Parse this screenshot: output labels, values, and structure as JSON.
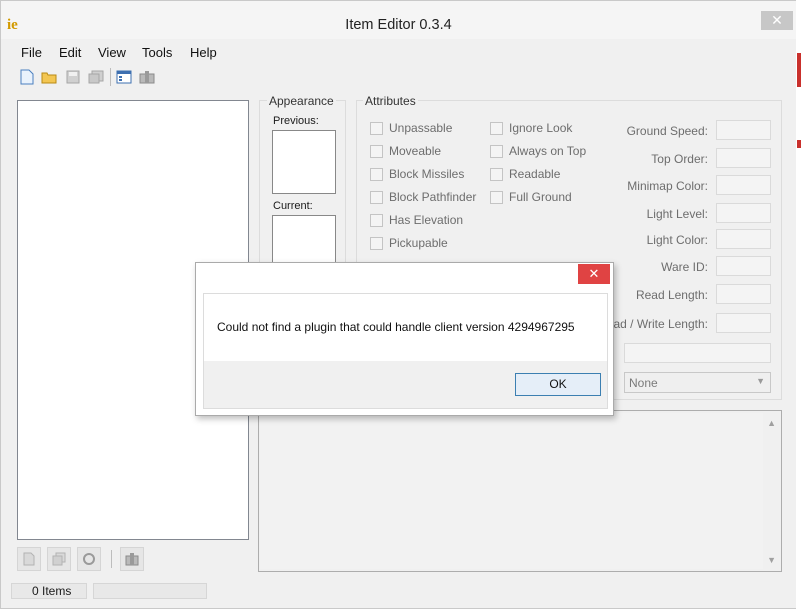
{
  "window": {
    "title": "Item Editor 0.3.4",
    "app_icon_text": "ie",
    "close_label": "✕"
  },
  "menu": [
    {
      "label": "File"
    },
    {
      "label": "Edit"
    },
    {
      "label": "View"
    },
    {
      "label": "Tools"
    },
    {
      "label": "Help"
    }
  ],
  "toolbar": [
    "new-file-icon",
    "open-folder-icon",
    "save-icon",
    "save-as-icon",
    "item-properties-icon",
    "find-item-icon"
  ],
  "appearance": {
    "title": "Appearance",
    "previous_label": "Previous:",
    "current_label": "Current:"
  },
  "attributes": {
    "title": "Attributes",
    "left_checks": [
      {
        "label": "Unpassable"
      },
      {
        "label": "Moveable"
      },
      {
        "label": "Block Missiles"
      },
      {
        "label": "Block Pathfinder"
      },
      {
        "label": "Has Elevation"
      },
      {
        "label": "Pickupable"
      }
    ],
    "right_checks": [
      {
        "label": "Ignore Look"
      },
      {
        "label": "Always on Top"
      },
      {
        "label": "Readable"
      },
      {
        "label": "Full Ground"
      }
    ],
    "properties": [
      {
        "label": "Ground Speed:"
      },
      {
        "label": "Top Order:"
      },
      {
        "label": "Minimap Color:"
      },
      {
        "label": "Light Level:"
      },
      {
        "label": "Light Color:"
      },
      {
        "label": "Ware ID:"
      },
      {
        "label": "Read Length:"
      },
      {
        "label": "ead / Write Length:"
      }
    ],
    "type_select": "None"
  },
  "status": {
    "items": "0 Items"
  },
  "dialog": {
    "message": "Could not find a plugin that could handle client version 4294967295",
    "ok_label": "OK",
    "close_label": "✕"
  }
}
